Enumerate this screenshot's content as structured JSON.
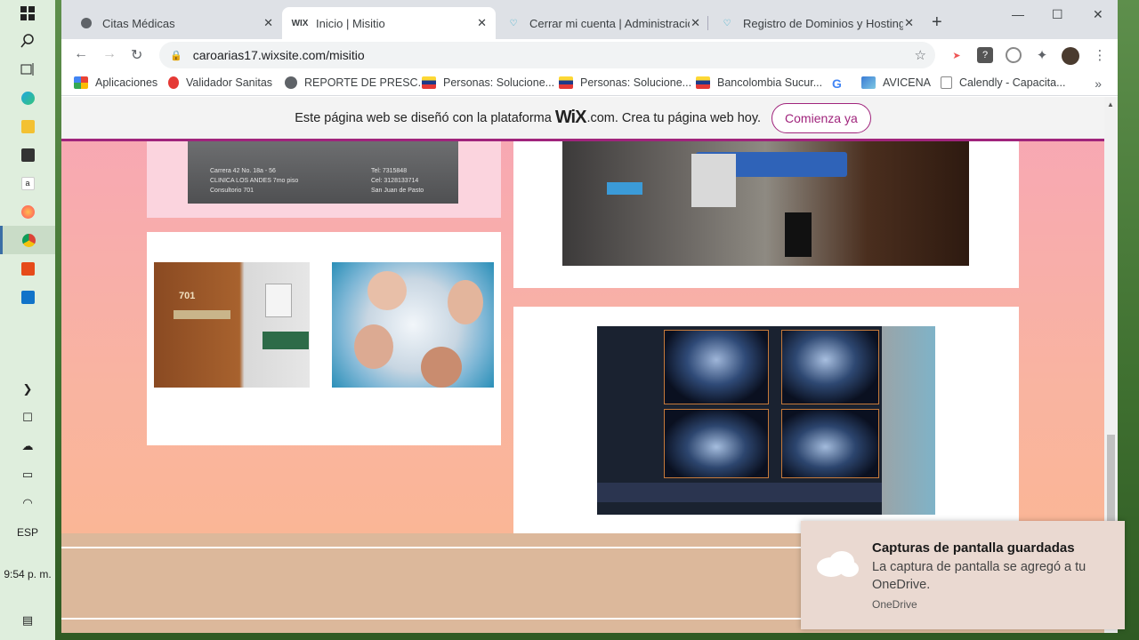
{
  "taskbar": {
    "language": "ESP",
    "clock": "9:54 p. m."
  },
  "tabs": [
    {
      "title": "Citas Médicas",
      "icon": "globe-icon"
    },
    {
      "title": "Inicio | Misitio",
      "icon": "wix-icon"
    },
    {
      "title": "Cerrar mi cuenta | Administración",
      "icon": "heart-icon"
    },
    {
      "title": "Registro de Dominios y Hosting c",
      "icon": "heart-icon"
    }
  ],
  "address": {
    "url": "caroarias17.wixsite.com/misitio"
  },
  "bookmarks": [
    {
      "label": "Aplicaciones"
    },
    {
      "label": "Validador Sanitas"
    },
    {
      "label": "REPORTE DE PRESC..."
    },
    {
      "label": "Personas: Solucione..."
    },
    {
      "label": "Personas: Solucione..."
    },
    {
      "label": "Bancolombia Sucur..."
    },
    {
      "label": ""
    },
    {
      "label": "AVICENA"
    },
    {
      "label": "Calendly - Capacita..."
    }
  ],
  "wix_banner": {
    "text_before": "Este página web se diseñó con la plataforma",
    "logo": "WiX",
    "domain": ".com",
    "text_after": ". Crea tu página web hoy.",
    "cta": "Comienza ya"
  },
  "photos": {
    "clinic_card": {
      "address": "Carrera 42 No. 18a - 56",
      "clinic": "CLINICA LOS ANDES 7mo piso",
      "office": "Consultorio 701",
      "tel": "Tel: 7315848",
      "cel": "Cel: 3128133714",
      "city": "San Juan de Pasto"
    },
    "door_number": "701"
  },
  "toast": {
    "title": "Capturas de pantalla guardadas",
    "body": "La captura de pantalla se agregó a tu OneDrive.",
    "source": "OneDrive"
  },
  "colors": {
    "wix_accent": "#a0247c",
    "taskbar": "#dfeedd",
    "page_gradient_top": "#f7a6b6",
    "page_gradient_bottom": "#fbb78f"
  }
}
